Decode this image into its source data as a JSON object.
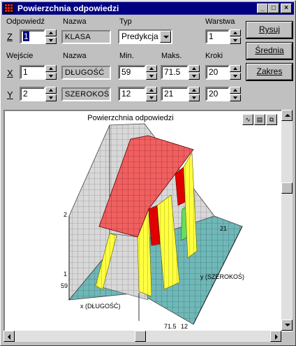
{
  "window": {
    "title": "Powierzchnia odpowiedzi"
  },
  "colors": {
    "titlebar": "#000080",
    "surface_red": "#f06060",
    "surface_yellow": "#ffff40",
    "floor_teal": "#70b8b8",
    "wall_grey": "#d8d8d8"
  },
  "top_row": {
    "odpowiedz_label": "Odpowiedź",
    "nazwa_label": "Nazwa",
    "typ_label": "Typ",
    "warstwa_label": "Warstwa",
    "z_label": "Z",
    "z_value": "1",
    "z_name": "KLASA",
    "typ_value": "Predykcja",
    "warstwa_value": "1"
  },
  "inputs_header": {
    "wejscie_label": "Wejście",
    "nazwa_label": "Nazwa",
    "min_label": "Min.",
    "maks_label": "Maks.",
    "kroki_label": "Kroki"
  },
  "x_row": {
    "label": "X",
    "value": "1",
    "name": "DŁUGOŚĆ",
    "min": "59",
    "max": "71.5",
    "steps": "20"
  },
  "y_row": {
    "label": "Y",
    "value": "2",
    "name": "SZEROKOŚ",
    "min": "12",
    "max": "21",
    "steps": "20"
  },
  "buttons": {
    "rysuj": "Rysuj",
    "srednia": "Średnia",
    "zakres": "Zakres"
  },
  "chart": {
    "title": "Powierzchnia odpowiedzi",
    "z_tick_top": "2",
    "z_tick_bottom": "1",
    "x_axis_label": "x (DŁUGOŚĆ)",
    "y_axis_label": "y (SZEROKOŚ)",
    "x_tick_min": "59",
    "x_tick_max": "71.5",
    "y_tick_min": "12",
    "y_tick_max": "21",
    "toolbar_icons": [
      "chart-type-icon",
      "save-icon",
      "copy-icon"
    ]
  },
  "chart_data": {
    "type": "surface",
    "title": "Powierzchnia odpowiedzi",
    "xlabel": "x (DŁUGOŚĆ)",
    "ylabel": "y (SZEROKOŚ)",
    "xlim": [
      59,
      71.5
    ],
    "ylim": [
      12,
      21
    ],
    "zlim": [
      1,
      2
    ],
    "description_levels": [
      1,
      2
    ]
  }
}
